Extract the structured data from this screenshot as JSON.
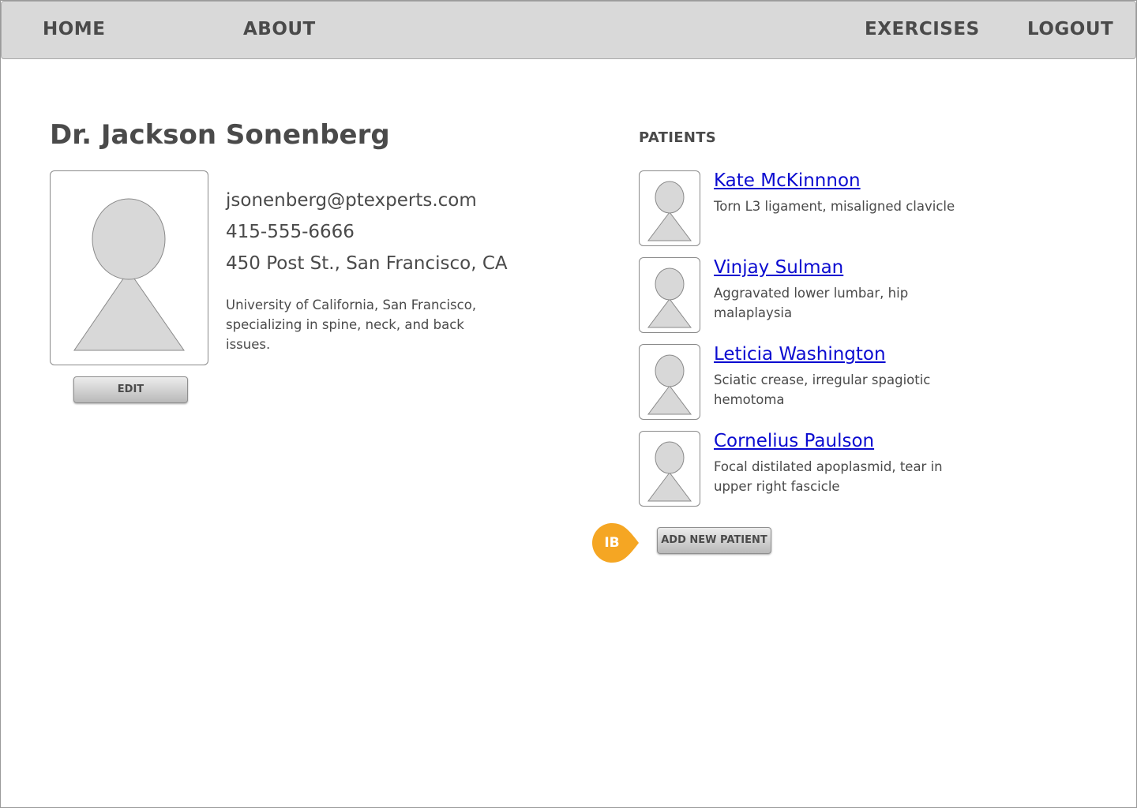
{
  "nav": {
    "home": "HOME",
    "about": "ABOUT",
    "exercises": "EXERCISES",
    "logout": "LOGOUT"
  },
  "doctor": {
    "name": "Dr. Jackson Sonenberg",
    "email": "jsonenberg@ptexperts.com",
    "phone": "415-555-6666",
    "address": "450 Post St., San Francisco, CA",
    "bio": "University of California, San Francisco, specializing in  spine, neck, and back issues.",
    "edit_label": "EDIT",
    "avatar_icon": "user-placeholder-icon"
  },
  "patients": {
    "title": "PATIENTS",
    "items": [
      {
        "name": "Kate McKinnnon",
        "condition": "Torn L3 ligament, misaligned clavicle"
      },
      {
        "name": "Vinjay Sulman",
        "condition": "Aggravated lower lumbar, hip malaplaysia"
      },
      {
        "name": "Leticia Washington",
        "condition": "Sciatic crease, irregular spagiotic hemotoma"
      },
      {
        "name": "Cornelius Paulson",
        "condition": "Focal distilated apoplasmid,  tear in upper right fascicle"
      }
    ],
    "add_label": "ADD NEW PATIENT"
  },
  "annotation": {
    "initials": "IB",
    "color": "#f5a623"
  },
  "colors": {
    "nav_bg": "#d9d9d9",
    "link": "#0b0bd0",
    "text": "#4a4a4a"
  }
}
